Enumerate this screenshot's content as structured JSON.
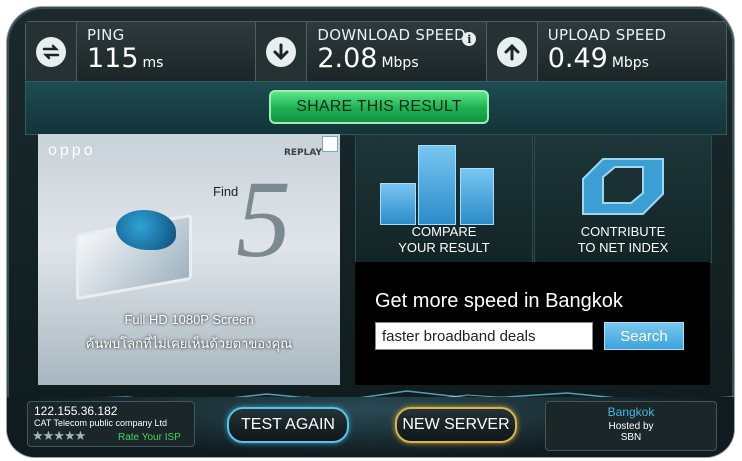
{
  "stats": {
    "ping": {
      "label": "PING",
      "value": "115",
      "unit": "ms",
      "icon": "swap-arrows-icon"
    },
    "download": {
      "label": "DOWNLOAD SPEED",
      "value": "2.08",
      "unit": "Mbps",
      "icon": "arrow-down-icon",
      "info_icon": "info-icon"
    },
    "upload": {
      "label": "UPLOAD SPEED",
      "value": "0.49",
      "unit": "Mbps",
      "icon": "arrow-up-icon"
    }
  },
  "share": {
    "label": "SHARE THIS RESULT"
  },
  "ad": {
    "brand": "oppo",
    "replay": "REPLAY",
    "find": "Find",
    "five": "5",
    "caption_line1": "Full HD 1080P Screen",
    "caption_line2": "ค้นพบโลกที่ไม่เคยเห็นด้วยตาของคุณ"
  },
  "tiles": {
    "compare": {
      "line1": "COMPARE",
      "line2": "YOUR RESULT"
    },
    "contribute": {
      "line1": "CONTRIBUTE",
      "line2": "TO NET INDEX"
    }
  },
  "promo": {
    "headline": "Get more speed in Bangkok",
    "search_value": "faster broadband deals",
    "search_button": "Search"
  },
  "isp": {
    "ip": "122.155.36.182",
    "company": "CAT Telecom public company Ltd",
    "stars": "★★★★★",
    "rate_label": "Rate Your ISP"
  },
  "buttons": {
    "test_again": "TEST AGAIN",
    "new_server": "NEW SERVER"
  },
  "server": {
    "city": "Bangkok",
    "hosted_by": "Hosted by",
    "host": "SBN"
  },
  "colors": {
    "accent_green": "#20b455",
    "accent_blue": "#58c4e6",
    "accent_gold": "#d8b64a",
    "panel": "#1b2527"
  }
}
